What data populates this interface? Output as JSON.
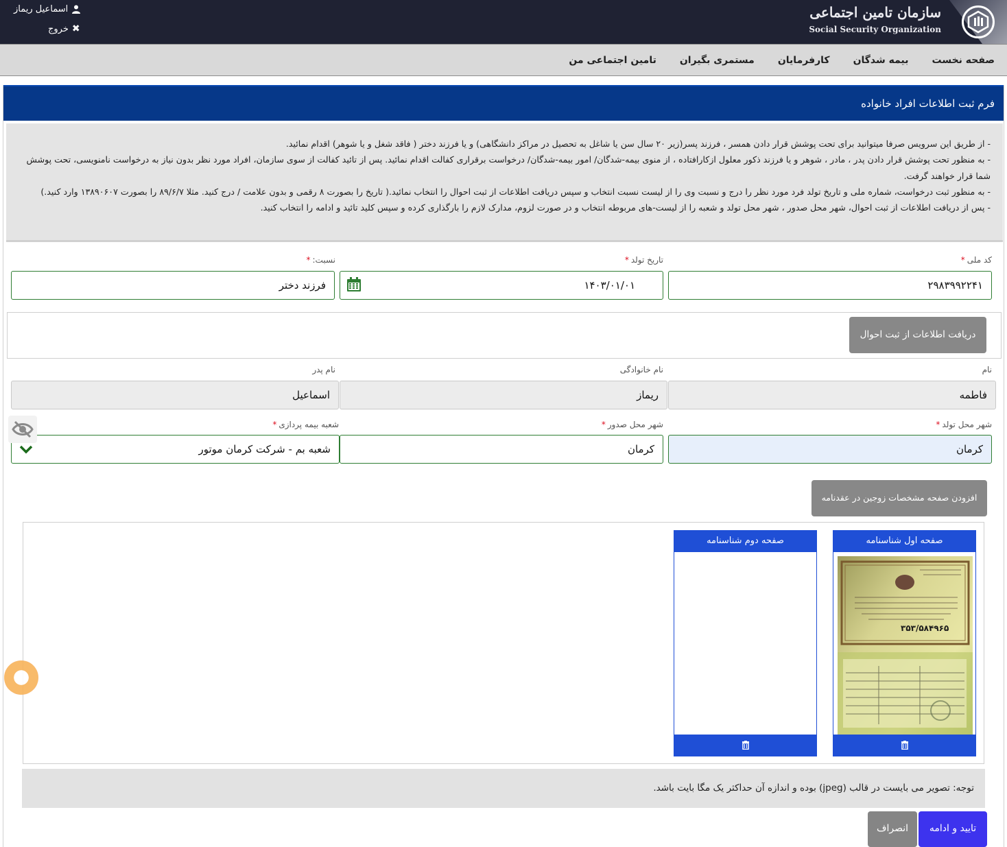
{
  "header": {
    "org_name_fa": "سازمان تامین اجتماعی",
    "org_name_en": "Social Security Organization",
    "user_name": "اسماعیل ریماز",
    "logout_label": "خروج"
  },
  "nav": {
    "items": [
      {
        "label": "صفحه نخست"
      },
      {
        "label": "بیمه شدگان"
      },
      {
        "label": "کارفرمایان"
      },
      {
        "label": "مستمری بگیران"
      },
      {
        "label": "تامین اجتماعی من"
      }
    ]
  },
  "form": {
    "title": "فرم ثبت اطلاعات افراد خانواده",
    "instructions": [
      "- از طریق این سرویس صرفا میتوانید برای تحت پوشش قرار دادن همسر ، فرزند پسر(زیر ۲۰ سال سن یا شاغل به تحصیل در مراکز دانشگاهی) و یا فرزند دختر ( فاقد شغل و یا شوهر) اقدام نمائید.",
      "- به منظور تحت پوشش قرار دادن پدر ، مادر ، شوهر و یا فرزند ذکور معلول ازکارافتاده ، از منوی بیمه‌-شدگان/ امور بیمه‌-شدگان/ درخواست برقراری کفالت اقدام نمائید. پس از تائید کفالت از سوی سازمان، افراد مورد نظر بدون نیاز به درخواست نامنویسی، تحت پوشش شما قرار خواهند گرفت.",
      "- به منظور ثبت درخواست، شماره ملی و تاریخ تولد فرد مورد نظر را درج و نسبت وی را از لیست نسبت انتخاب و سپس دریافت اطلاعات از ثبت احوال را انتخاب نمائید.( تاریخ را بصورت ۸ رقمی و بدون علامت / درج کنید. مثلا ۸۹/۶/۷ را بصورت ۱۳۸۹۰۶۰۷ وارد کنید.)",
      "- پس از دریافت اطلاعات از ثبت احوال، شهر محل صدور ، شهر محل تولد و شعبه را از لیست‌-های مربوطه انتخاب و در صورت لزوم، مدارک لازم را بارگذاری کرده و سپس کلید تائید و ادامه را انتخاب کنید."
    ],
    "national_code": {
      "label": "کد ملی",
      "value": "۲۹۸۳۹۹۲۲۴۱"
    },
    "birth_date": {
      "label": "تاریخ تولد",
      "value": "۱۴۰۳/۰۱/۰۱"
    },
    "relation": {
      "label": "نسبت:",
      "value": "فرزند دختر"
    },
    "fetch_button": "دریافت اطلاعات از ثبت احوال",
    "first_name": {
      "label": "نام",
      "value": "فاطمه"
    },
    "last_name": {
      "label": "نام خانوادگی",
      "value": "ریماز"
    },
    "father_name": {
      "label": "نام پدر",
      "value": "اسماعیل"
    },
    "birth_city": {
      "label": "شهر محل تولد",
      "value": "کرمان"
    },
    "issue_city": {
      "label": "شهر محل صدور",
      "value": "کرمان"
    },
    "branch": {
      "label": "شعبه بیمه پردازی",
      "value": "شعبه بم - شرکت کرمان موتور"
    },
    "add_page_button": "افزودن صفحه مشخصات زوجین در عقدنامه",
    "upload_cards": [
      {
        "title": "صفحه اول شناسنامه"
      },
      {
        "title": "صفحه دوم شناسنامه"
      }
    ],
    "document_number": "۳۵۳/۵۸۴۹۶۵",
    "note": "توجه: تصویر می بایست در قالب (jpeg) بوده و اندازه آن حداکثر یک مگا بایت باشد.",
    "confirm_button": "تایید و ادامه",
    "cancel_button": "انصراف"
  },
  "colors": {
    "header_bg": "#1f2233",
    "panel_head_bg": "#063889",
    "card_blue": "#1f4fd6",
    "primary_button": "#3d33ee",
    "valid_border": "#2e7d32"
  }
}
